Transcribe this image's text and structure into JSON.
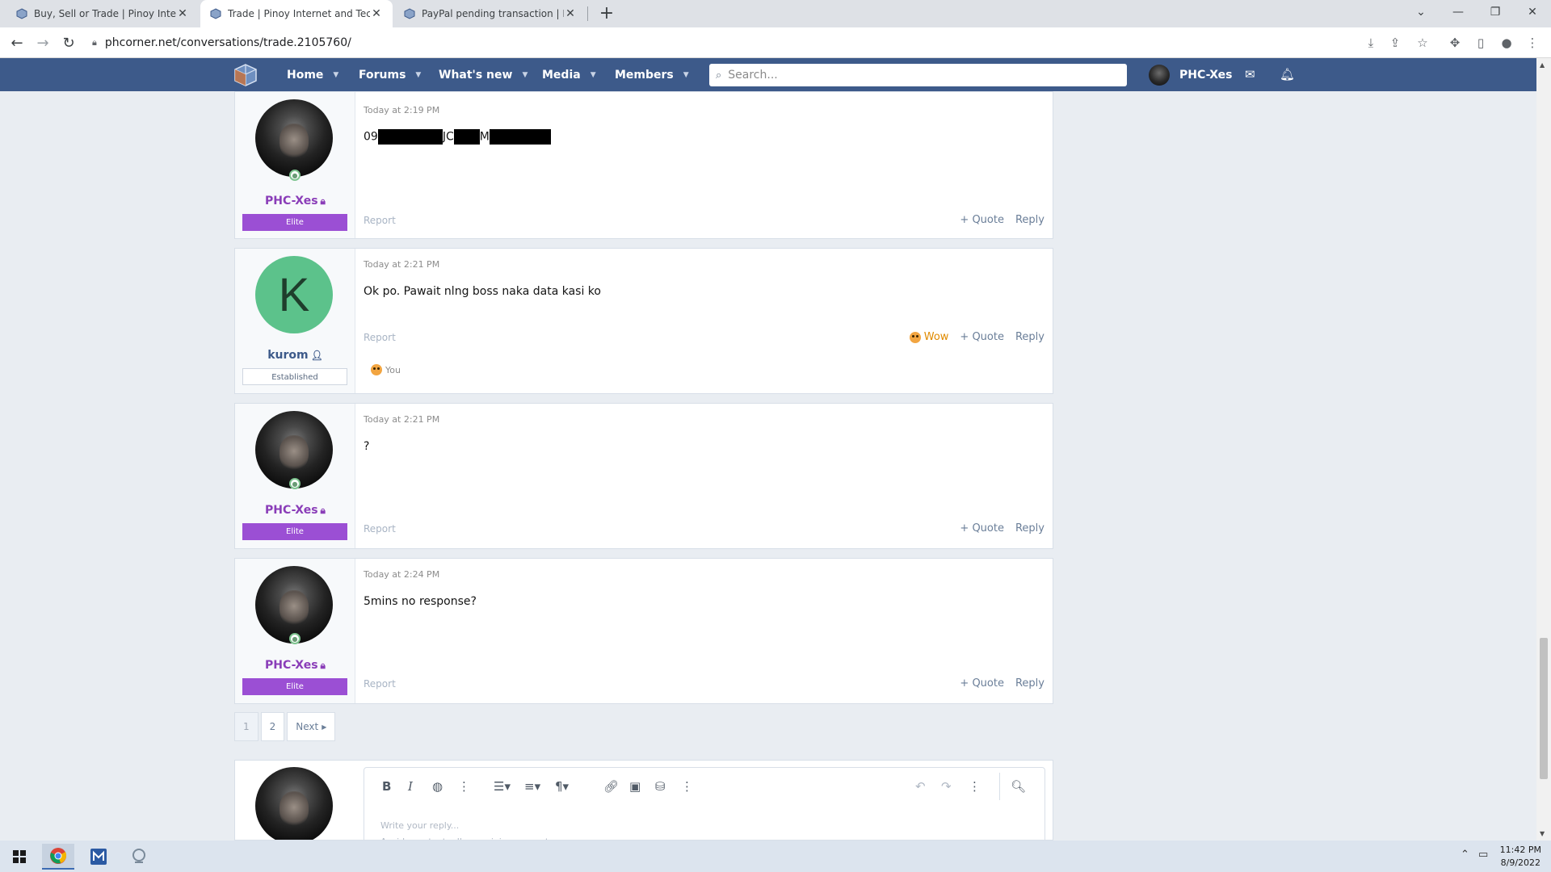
{
  "browser": {
    "tabs": [
      {
        "title": "Buy, Sell or Trade | Pinoy Internet",
        "active": false
      },
      {
        "title": "Trade | Pinoy Internet and Techno",
        "active": true
      },
      {
        "title": "PayPal pending transaction | Pino",
        "active": false
      }
    ],
    "url": "phcorner.net/conversations/trade.2105760/"
  },
  "site": {
    "nav": [
      "Home",
      "Forums",
      "What's new",
      "Media",
      "Members"
    ],
    "search_placeholder": "Search...",
    "current_user": "PHC-Xes"
  },
  "messages": [
    {
      "author": "PHC-Xes",
      "rank": "Elite",
      "time": "Today at 2:19 PM",
      "text_parts": [
        "09",
        "JC",
        "M"
      ],
      "report": "Report",
      "quote": "Quote",
      "reply": "Reply"
    },
    {
      "author": "kurom",
      "avatar_letter": "K",
      "rank": "Established",
      "time": "Today at 2:21 PM",
      "text": "Ok po. Pawait nlng boss naka data kasi ko",
      "report": "Report",
      "reaction_label": "Wow",
      "quote": "Quote",
      "reply": "Reply",
      "reacted_by": "You"
    },
    {
      "author": "PHC-Xes",
      "rank": "Elite",
      "time": "Today at 2:21 PM",
      "text": "?",
      "report": "Report",
      "quote": "Quote",
      "reply": "Reply"
    },
    {
      "author": "PHC-Xes",
      "rank": "Elite",
      "time": "Today at 2:24 PM",
      "text": "5mins no response?",
      "report": "Report",
      "quote": "Quote",
      "reply": "Reply"
    }
  ],
  "pagination": {
    "pages": [
      "1",
      "2"
    ],
    "current": "1",
    "next": "Next"
  },
  "editor": {
    "placeholder_line1": "Write your reply...",
    "placeholder_line2": "Avoid sms text, all caps, jejemon posts."
  },
  "taskbar": {
    "time": "11:42 PM",
    "date": "8/9/2022"
  },
  "colors": {
    "header": "#3d5a8a",
    "elite": "#9b4fd4",
    "avatar_k": "#5cc28b"
  }
}
